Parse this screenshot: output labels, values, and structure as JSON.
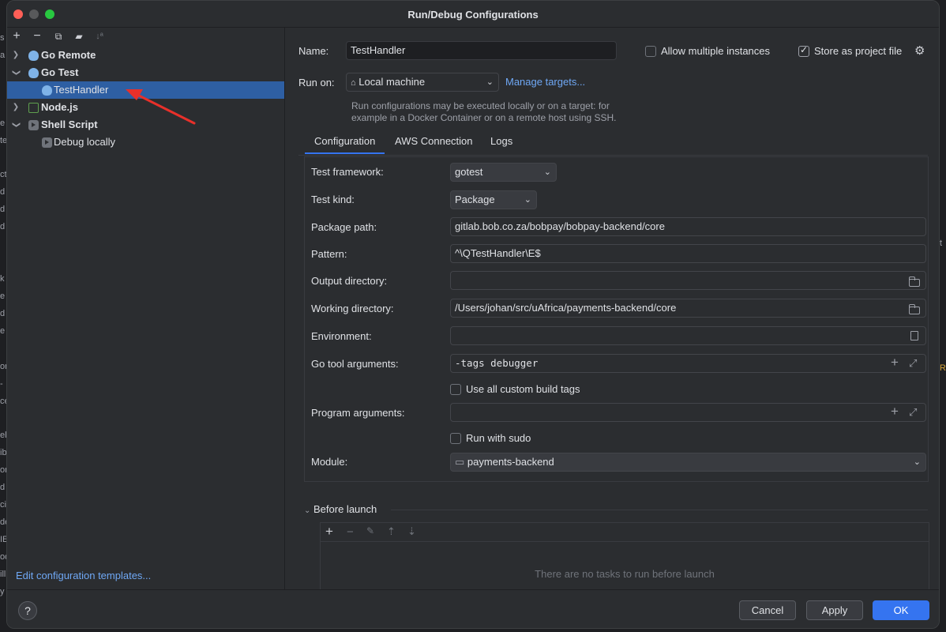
{
  "window": {
    "title": "Run/Debug Configurations"
  },
  "left_panel": {
    "tree": [
      {
        "label": "Go Remote",
        "bold": true,
        "expanded": false,
        "icon": "gopher-icon"
      },
      {
        "label": "Go Test",
        "bold": true,
        "expanded": true,
        "icon": "gopher-icon"
      },
      {
        "label": "TestHandler",
        "bold": false,
        "selected": true,
        "icon": "gopher-test-icon"
      },
      {
        "label": "Node.js",
        "bold": true,
        "expanded": false,
        "icon": "nodejs-icon"
      },
      {
        "label": "Shell Script",
        "bold": true,
        "expanded": true,
        "icon": "shell-script-icon"
      },
      {
        "label": "Debug locally",
        "bold": false,
        "icon": "shell-script-icon"
      }
    ],
    "edit_templates_link": "Edit configuration templates..."
  },
  "config": {
    "name_label": "Name:",
    "name_value": "TestHandler",
    "allow_multiple_label": "Allow multiple instances",
    "allow_multiple_checked": false,
    "store_project_label": "Store as project file",
    "store_project_checked": true,
    "run_on_label": "Run on:",
    "run_on_value": "Local machine",
    "manage_targets": "Manage targets...",
    "hint_line1": "Run configurations may be executed locally or on a target: for",
    "hint_line2": "example in a Docker Container or on a remote host using SSH."
  },
  "tabs": [
    {
      "label": "Configuration",
      "active": true
    },
    {
      "label": "AWS Connection",
      "active": false
    },
    {
      "label": "Logs",
      "active": false
    }
  ],
  "form": {
    "test_framework_label": "Test framework:",
    "test_framework_value": "gotest",
    "test_kind_label": "Test kind:",
    "test_kind_value": "Package",
    "package_path_label": "Package path:",
    "package_path_value": "gitlab.bob.co.za/bobpay/bobpay-backend/core",
    "pattern_label": "Pattern:",
    "pattern_value": "^\\QTestHandler\\E$",
    "output_dir_label": "Output directory:",
    "output_dir_value": "",
    "working_dir_label": "Working directory:",
    "working_dir_value": "/Users/johan/src/uAfrica/payments-backend/core",
    "environment_label": "Environment:",
    "environment_value": "",
    "go_tool_args_label": "Go tool arguments:",
    "go_tool_args_value": "-tags debugger",
    "use_all_tags_label": "Use all custom build tags",
    "use_all_tags_checked": false,
    "program_args_label": "Program arguments:",
    "program_args_value": "",
    "run_with_sudo_label": "Run with sudo",
    "run_with_sudo_checked": false,
    "module_label": "Module:",
    "module_value": "payments-backend"
  },
  "before_launch": {
    "title": "Before launch",
    "expanded": true,
    "empty_text": "There are no tasks to run before launch"
  },
  "buttons": {
    "help": "?",
    "cancel": "Cancel",
    "apply": "Apply",
    "ok": "OK"
  },
  "background": {
    "left_glyphs": [
      "s",
      "a",
      "",
      "",
      "e",
      "",
      "te",
      "",
      "ct",
      "d",
      "d",
      "d",
      "",
      "k",
      "e",
      "d",
      "e",
      "",
      "or",
      "-",
      "ce",
      "",
      "el",
      "ib",
      "or",
      "d",
      "ci",
      "de",
      "IE",
      "od",
      "ill",
      "y"
    ],
    "right_glyphs": [
      "t",
      "R"
    ]
  },
  "colors": {
    "accent": "#3574f0",
    "selection": "#2e5fa3",
    "link": "#6fa8f5",
    "annotation_arrow": "#e8302a"
  }
}
